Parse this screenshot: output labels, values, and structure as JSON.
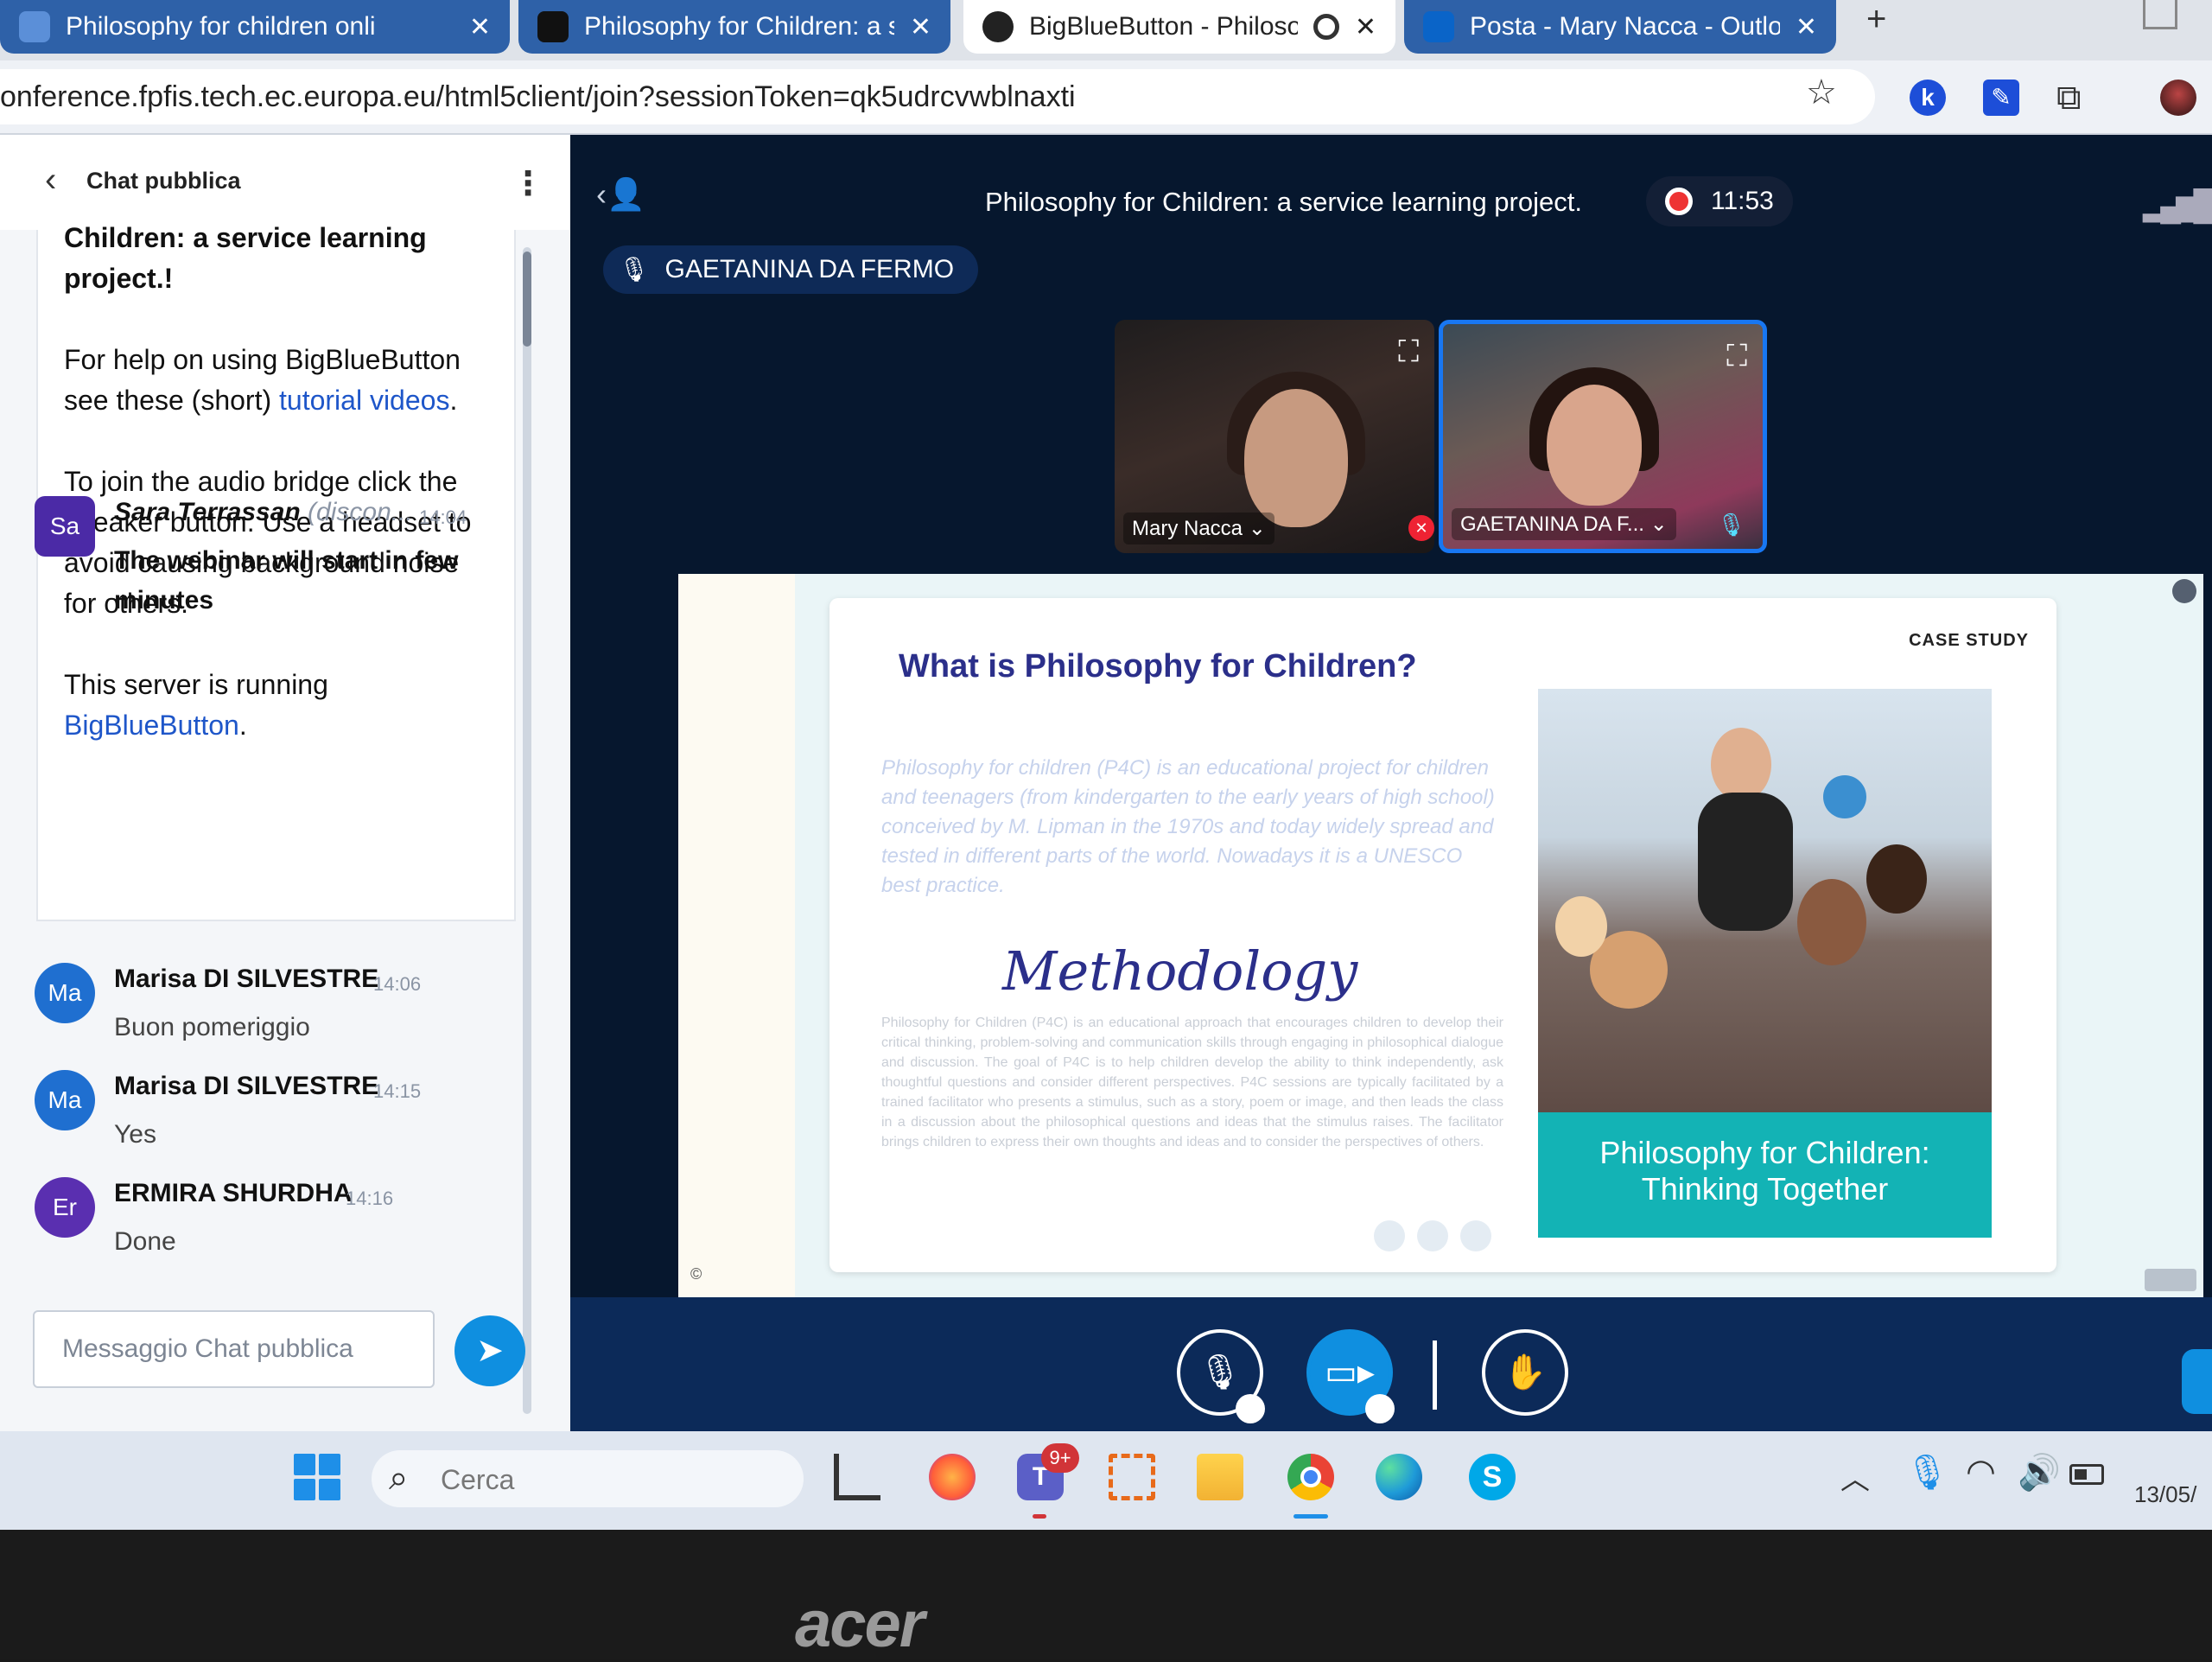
{
  "browser": {
    "tabs": [
      {
        "title": "Philosophy for children onli",
        "active": false
      },
      {
        "title": "Philosophy for Children: a se",
        "active": false
      },
      {
        "title": "BigBlueButton - Philosop",
        "active": true
      },
      {
        "title": "Posta - Mary Nacca - Outloo",
        "active": false
      }
    ],
    "close_glyph": "✕",
    "new_tab": "+",
    "url": "onference.fpfis.tech.ec.europa.eu/html5client/join?sessionToken=qk5udrcvwblnaxti"
  },
  "chat": {
    "title": "Chat pubblica",
    "welcome": {
      "fragment_line1": "Children: a service learning",
      "fragment_line2": "project.!",
      "help_prefix": "For help on using BigBlueButton see these (short) ",
      "help_link": "tutorial videos",
      "help_suffix": ".",
      "audio_text": "To join the audio bridge click the speaker button. Use a headset to avoid causing background noise for others.",
      "server_prefix": "This server is running ",
      "server_link": "BigBlueButton",
      "server_suffix": "."
    },
    "messages": [
      {
        "initials": "Sa",
        "name": "Sara Terrassan",
        "sub": " (discon...",
        "time": "14:04",
        "text": "The webinar will start in few minutes",
        "color": "#4b2aa6"
      },
      {
        "initials": "Ma",
        "name": "Marisa DI SILVESTRE",
        "sub": "",
        "time": "14:06",
        "text": "Buon pomeriggio",
        "color": "#1f6fd0"
      },
      {
        "initials": "Ma",
        "name": "Marisa DI SILVESTRE",
        "sub": "",
        "time": "14:15",
        "text": "Yes",
        "color": "#1f6fd0"
      },
      {
        "initials": "Er",
        "name": "ERMIRA SHURDHA",
        "sub": "",
        "time": "14:16",
        "text": "Done",
        "color": "#5a2fb0"
      }
    ],
    "input_placeholder": "Messaggio Chat pubblica"
  },
  "meeting": {
    "title": "Philosophy for Children: a service learning project.",
    "recording_time": "11:53",
    "talker": "GAETANINA DA FERMO",
    "videos": [
      {
        "name": "Mary Nacca"
      },
      {
        "name": "GAETANINA DA F..."
      }
    ]
  },
  "slide": {
    "case_study": "CASE STUDY",
    "heading": "What is Philosophy for Children?",
    "intro": "Philosophy for children (P4C) is an educational project for children and teenagers (from kindergarten to the early years of high school) conceived by M. Lipman in the 1970s and today widely spread and tested in different parts of the world. Nowadays it is a UNESCO best practice.",
    "methodology_title": "Methodology",
    "methodology_body": "Philosophy for Children (P4C) is an educational approach that encourages children to develop their critical thinking, problem-solving and communication skills through engaging in philosophical dialogue and discussion. The goal of P4C is to help children develop the ability to think independently, ask thoughtful questions and consider different perspectives. P4C sessions are typically facilitated by a trained facilitator who presents a stimulus, such as a story, poem or image, and then leads the class in a discussion about the philosophical questions and ideas that the stimulus raises. The facilitator brings children to express their own thoughts and ideas and to consider the perspectives of others.",
    "caption": "Philosophy for Children: Thinking Together"
  },
  "taskbar": {
    "search_placeholder": "Cerca",
    "teams_badge": "9+",
    "date": "13/05/"
  },
  "laptop": {
    "brand": "acer"
  },
  "colors": {
    "bbb_bg": "#06172e",
    "action_bar": "#0c2a59",
    "accent": "#0f8fe0",
    "slide_heading": "#2b2f8a",
    "caption_bg": "#13b3b5"
  }
}
